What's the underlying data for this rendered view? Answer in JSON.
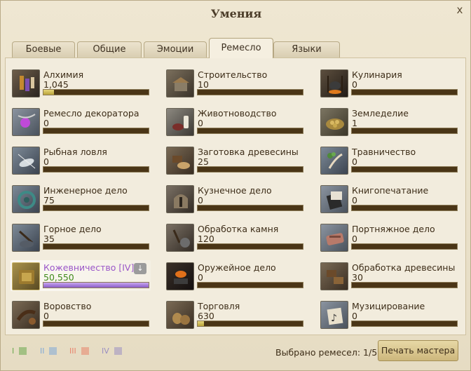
{
  "window": {
    "title": "Умения",
    "close_label": "x"
  },
  "tabs": [
    {
      "label": "Боевые"
    },
    {
      "label": "Общие"
    },
    {
      "label": "Эмоции"
    },
    {
      "label": "Ремесло",
      "active": true
    },
    {
      "label": "Языки"
    }
  ],
  "skills": [
    {
      "name": "Алхимия",
      "value": "1,045",
      "progress": 0.1,
      "icon": "alchemy-icon"
    },
    {
      "name": "Строительство",
      "value": "10",
      "progress": 0,
      "icon": "construction-icon"
    },
    {
      "name": "Кулинария",
      "value": "0",
      "progress": 0,
      "icon": "cooking-icon"
    },
    {
      "name": "Ремесло декоратора",
      "value": "0",
      "progress": 0,
      "icon": "handicrafts-icon"
    },
    {
      "name": "Животноводство",
      "value": "0",
      "progress": 0,
      "icon": "husbandry-icon"
    },
    {
      "name": "Земледелие",
      "value": "1",
      "progress": 0,
      "icon": "farming-icon"
    },
    {
      "name": "Рыбная ловля",
      "value": "0",
      "progress": 0,
      "icon": "fishing-icon"
    },
    {
      "name": "Заготовка древесины",
      "value": "25",
      "progress": 0,
      "icon": "logging-icon"
    },
    {
      "name": "Травничество",
      "value": "0",
      "progress": 0,
      "icon": "herbalism-icon"
    },
    {
      "name": "Инженерное дело",
      "value": "75",
      "progress": 0,
      "icon": "machining-icon"
    },
    {
      "name": "Кузнечное дело",
      "value": "0",
      "progress": 0,
      "icon": "metalwork-icon"
    },
    {
      "name": "Книгопечатание",
      "value": "0",
      "progress": 0,
      "icon": "printing-icon"
    },
    {
      "name": "Горное дело",
      "value": "35",
      "progress": 0,
      "icon": "mining-icon"
    },
    {
      "name": "Обработка камня",
      "value": "120",
      "progress": 0,
      "icon": "masonry-icon"
    },
    {
      "name": "Портняжное дело",
      "value": "0",
      "progress": 0,
      "icon": "tailoring-icon"
    },
    {
      "name": "Кожевничество [IV]",
      "value": "50,550",
      "progress": 1.0,
      "icon": "leatherwork-icon",
      "special": true
    },
    {
      "name": "Оружейное дело",
      "value": "0",
      "progress": 0,
      "icon": "weaponry-icon"
    },
    {
      "name": "Обработка древесины",
      "value": "30",
      "progress": 0,
      "icon": "carpentry-icon"
    },
    {
      "name": "Воровство",
      "value": "0",
      "progress": 0,
      "icon": "larceny-icon"
    },
    {
      "name": "Торговля",
      "value": "630",
      "progress": 0.06,
      "icon": "commerce-icon"
    },
    {
      "name": "Музицирование",
      "value": "0",
      "progress": 0,
      "icon": "composition-icon"
    }
  ],
  "tiers": [
    {
      "label": "I",
      "color": "#6aa84f"
    },
    {
      "label": "II",
      "color": "#7fa9d8"
    },
    {
      "label": "III",
      "color": "#e8836c"
    },
    {
      "label": "IV",
      "color": "#9a8fc2"
    }
  ],
  "footer": {
    "selected_count": "Выбрано ремесел: 1/5",
    "print_button": "Печать мастера"
  },
  "colors": {
    "progress_fill": "#d1bf5a",
    "special_fill": "#a67ddb",
    "special_name": "#9a56c8",
    "special_value": "#3f8a1a"
  }
}
